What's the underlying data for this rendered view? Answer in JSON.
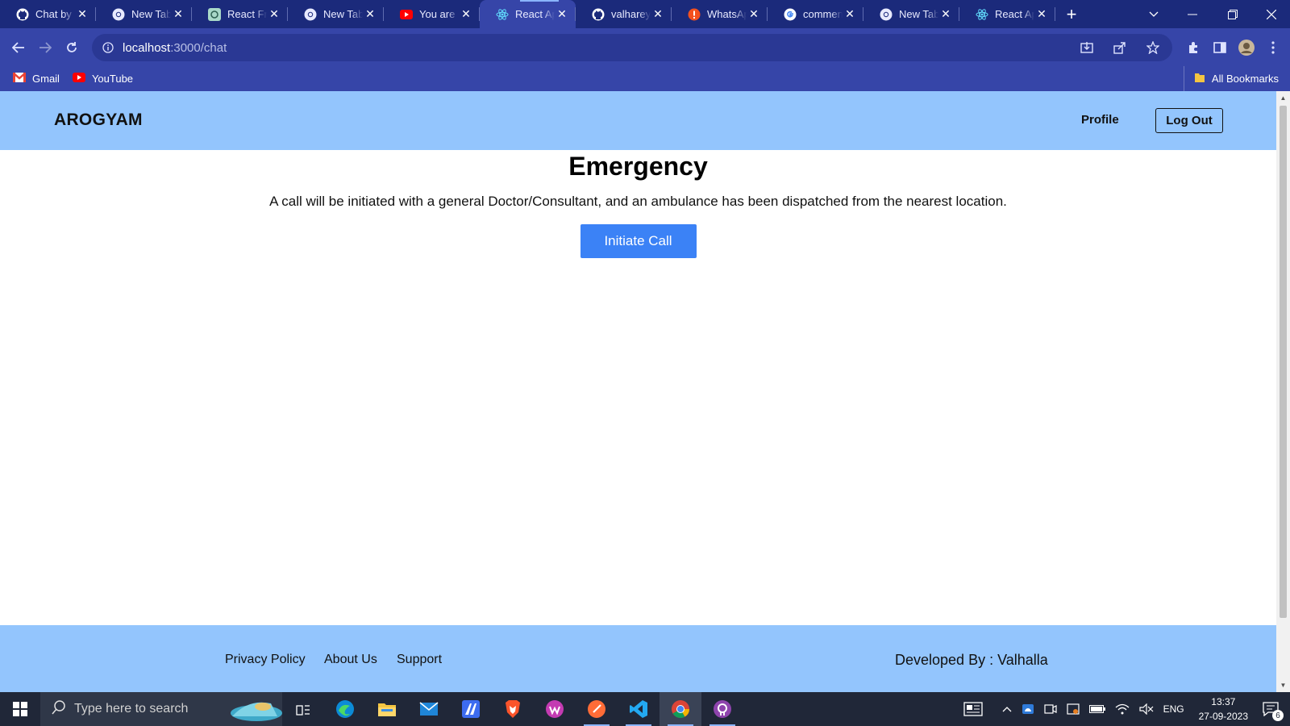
{
  "browser": {
    "tabs": [
      {
        "title": "Chat by l",
        "icon": "github-icon",
        "active": false
      },
      {
        "title": "New Tab",
        "icon": "chrome-icon",
        "active": false
      },
      {
        "title": "React Frc",
        "icon": "openai-icon",
        "active": false
      },
      {
        "title": "New Tab",
        "icon": "chrome-icon",
        "active": false
      },
      {
        "title": "You are l",
        "icon": "youtube-icon",
        "active": false
      },
      {
        "title": "React Ap",
        "icon": "react-icon",
        "active": true
      },
      {
        "title": "valharey",
        "icon": "github-icon",
        "active": false
      },
      {
        "title": "WhatsAp",
        "icon": "whatsapp-icon",
        "active": false
      },
      {
        "title": "commen",
        "icon": "google-icon",
        "active": false
      },
      {
        "title": "New Tab",
        "icon": "chrome-icon",
        "active": false
      },
      {
        "title": "React Ap",
        "icon": "react-icon",
        "active": false
      }
    ],
    "url_host": "localhost",
    "url_rest": ":3000/chat",
    "bookmarks": [
      {
        "label": "Gmail",
        "icon": "gmail-icon"
      },
      {
        "label": "YouTube",
        "icon": "youtube-icon"
      }
    ],
    "all_bookmarks_label": "All Bookmarks"
  },
  "app": {
    "brand": "AROGYAM",
    "nav": {
      "profile": "Profile",
      "logout": "Log Out"
    },
    "page": {
      "title": "Emergency",
      "message": "A call will be initiated with a general Doctor/Consultant, and an ambulance has been dispatched from the nearest location.",
      "button": "Initiate Call"
    },
    "footer": {
      "links": [
        "Privacy Policy",
        "About Us",
        "Support"
      ],
      "developed_by": "Developed By : Valhalla"
    },
    "colors": {
      "navbar": "#93c5fd",
      "button": "#3b82f6"
    }
  },
  "taskbar": {
    "search_placeholder": "Type here to search",
    "language": "ENG",
    "time": "13:37",
    "date": "27-09-2023",
    "notifications": "6"
  }
}
